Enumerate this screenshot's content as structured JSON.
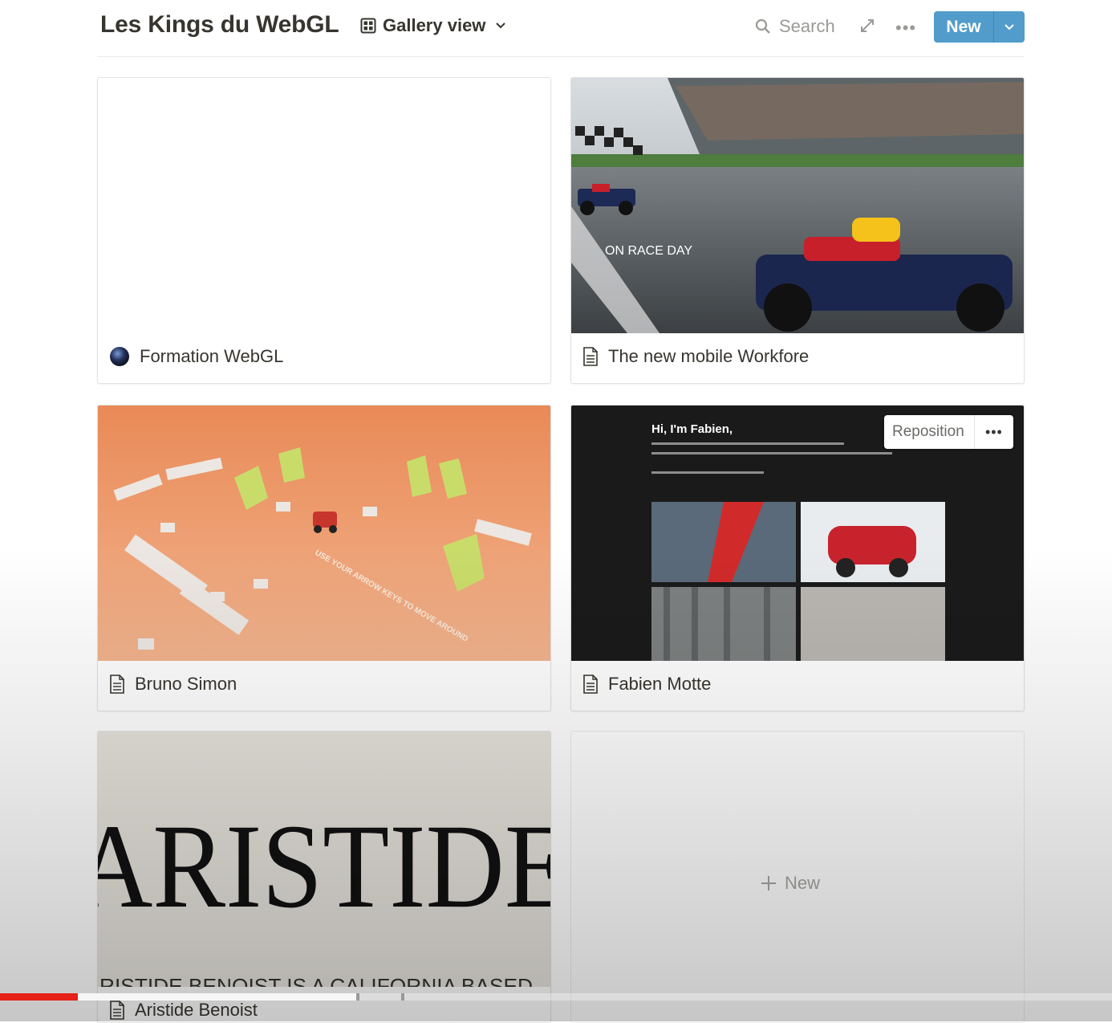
{
  "header": {
    "title": "Les Kings du WebGL",
    "view_label": "Gallery view",
    "search_label": "Search",
    "new_label": "New"
  },
  "cards": [
    {
      "title": "Formation WebGL",
      "icon": "sphere-icon"
    },
    {
      "title": "The new mobile Workfore",
      "icon": "page-icon",
      "cover_text": "ON RACE DAY"
    },
    {
      "title": "Bruno Simon",
      "icon": "page-icon",
      "cover_text": "USE YOUR ARROW KEYS TO MOVE AROUND"
    },
    {
      "title": "Fabien Motte",
      "icon": "page-icon",
      "cover_text": "Hi, I'm Fabien,",
      "cover_buttons": {
        "reposition": "Reposition"
      }
    },
    {
      "title": "Aristide Benoist",
      "icon": "page-icon",
      "cover_text": "ARISTIDE",
      "cover_subtext": "RISTIDE BENOIST IS A CALIFORNIA BASED"
    }
  ],
  "new_card": {
    "label": "New"
  },
  "video_progress": {
    "played_fraction": 0.07,
    "buffered_fraction": 0.32
  },
  "colors": {
    "accent": "#529ccb",
    "progress": "#e62117",
    "text": "#37352f",
    "muted": "#9b9a97"
  }
}
